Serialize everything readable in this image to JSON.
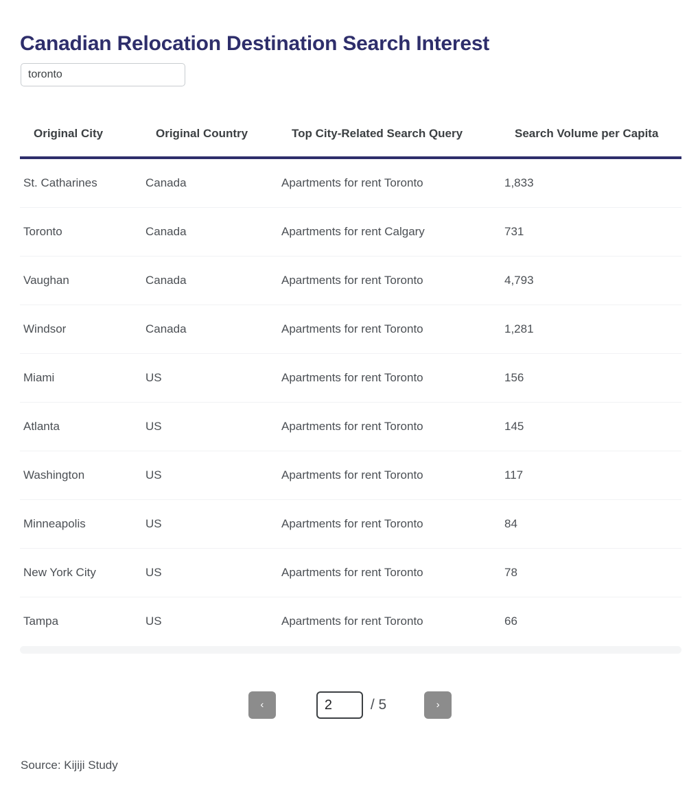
{
  "page": {
    "title": "Canadian Relocation Destination Search Interest",
    "source_note": "Source: Kijiji Study",
    "accent_color": "#2e2e6b",
    "text_color": "#4b4f54",
    "button_color": "#8c8c8c"
  },
  "search": {
    "value": "toronto",
    "placeholder": "Search"
  },
  "table": {
    "columns": [
      {
        "label": "Original City"
      },
      {
        "label": "Original Country"
      },
      {
        "label": "Top City-Related Search Query"
      },
      {
        "label": "Search Volume per Capita"
      }
    ],
    "rows": [
      {
        "city": "St. Catharines",
        "country": "Canada",
        "query": "Apartments for rent Toronto",
        "volume": "1,833"
      },
      {
        "city": "Toronto",
        "country": "Canada",
        "query": "Apartments for rent Calgary",
        "volume": "731"
      },
      {
        "city": "Vaughan",
        "country": "Canada",
        "query": "Apartments for rent Toronto",
        "volume": "4,793"
      },
      {
        "city": "Windsor",
        "country": "Canada",
        "query": "Apartments for rent Toronto",
        "volume": "1,281"
      },
      {
        "city": "Miami",
        "country": "US",
        "query": "Apartments for rent Toronto",
        "volume": "156"
      },
      {
        "city": "Atlanta",
        "country": "US",
        "query": "Apartments for rent Toronto",
        "volume": "145"
      },
      {
        "city": "Washington",
        "country": "US",
        "query": "Apartments for rent Toronto",
        "volume": "117"
      },
      {
        "city": "Minneapolis",
        "country": "US",
        "query": "Apartments for rent Toronto",
        "volume": "84"
      },
      {
        "city": "New York City",
        "country": "US",
        "query": "Apartments for rent Toronto",
        "volume": "78"
      },
      {
        "city": "Tampa",
        "country": "US",
        "query": "Apartments for rent Toronto",
        "volume": "66"
      }
    ]
  },
  "pagination": {
    "prev_label": "‹",
    "prev_icon": "chevron-left-icon",
    "next_label": "›",
    "next_icon": "chevron-right-icon",
    "current_page": "2",
    "total_label": "/ 5",
    "total_pages": "5"
  },
  "chart_data": {
    "type": "table",
    "title": "Canadian Relocation Destination Search Interest",
    "filter_query": "toronto",
    "columns": [
      "Original City",
      "Original Country",
      "Top City-Related Search Query",
      "Search Volume per Capita"
    ],
    "rows": [
      [
        "St. Catharines",
        "Canada",
        "Apartments for rent Toronto",
        1833
      ],
      [
        "Toronto",
        "Canada",
        "Apartments for rent Calgary",
        731
      ],
      [
        "Vaughan",
        "Canada",
        "Apartments for rent Toronto",
        4793
      ],
      [
        "Windsor",
        "Canada",
        "Apartments for rent Toronto",
        1281
      ],
      [
        "Miami",
        "US",
        "Apartments for rent Toronto",
        156
      ],
      [
        "Atlanta",
        "US",
        "Apartments for rent Toronto",
        145
      ],
      [
        "Washington",
        "US",
        "Apartments for rent Toronto",
        117
      ],
      [
        "Minneapolis",
        "US",
        "Apartments for rent Toronto",
        84
      ],
      [
        "New York City",
        "US",
        "Apartments for rent Toronto",
        78
      ],
      [
        "Tampa",
        "US",
        "Apartments for rent Toronto",
        66
      ]
    ],
    "page": 2,
    "total_pages": 5,
    "source": "Source: Kijiji Study"
  }
}
